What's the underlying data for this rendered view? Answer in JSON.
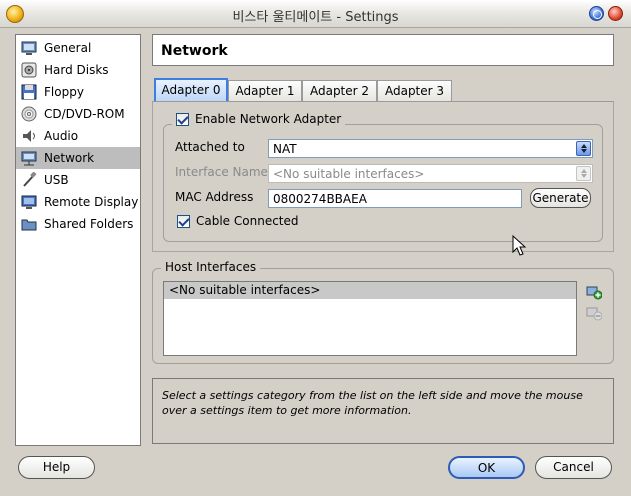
{
  "window": {
    "title": "비스타 울티메이트 - Settings"
  },
  "sidebar": {
    "items": [
      {
        "label": "General",
        "icon": "general-icon",
        "selected": false
      },
      {
        "label": "Hard Disks",
        "icon": "hard-disk-icon",
        "selected": false
      },
      {
        "label": "Floppy",
        "icon": "floppy-icon",
        "selected": false
      },
      {
        "label": "CD/DVD-ROM",
        "icon": "cd-dvd-icon",
        "selected": false
      },
      {
        "label": "Audio",
        "icon": "audio-icon",
        "selected": false
      },
      {
        "label": "Network",
        "icon": "network-icon",
        "selected": true
      },
      {
        "label": "USB",
        "icon": "usb-icon",
        "selected": false
      },
      {
        "label": "Remote Display",
        "icon": "remote-display-icon",
        "selected": false
      },
      {
        "label": "Shared Folders",
        "icon": "shared-folders-icon",
        "selected": false
      }
    ]
  },
  "header": {
    "title": "Network"
  },
  "tabs": [
    {
      "label": "Adapter 0",
      "active": true
    },
    {
      "label": "Adapter 1",
      "active": false
    },
    {
      "label": "Adapter 2",
      "active": false
    },
    {
      "label": "Adapter 3",
      "active": false
    }
  ],
  "adapter": {
    "enable_label": "Enable Network Adapter",
    "enable_checked": true,
    "attached_label": "Attached to",
    "attached_value": "NAT",
    "interface_label": "Interface Name",
    "interface_value": "<No suitable interfaces>",
    "mac_label": "MAC Address",
    "mac_value": "0800274BBAEA",
    "generate_label": "Generate",
    "cable_label": "Cable Connected",
    "cable_checked": true
  },
  "host": {
    "title": "Host Interfaces",
    "items": [
      "<No suitable interfaces>"
    ]
  },
  "info": {
    "text": "Select a settings category from the list on the left side and move the mouse over a settings item to get more information."
  },
  "buttons": {
    "help": "Help",
    "ok": "OK",
    "cancel": "Cancel"
  },
  "colors": {
    "accent": "#3f7ddf",
    "selection": "#bdbdbd",
    "window_bg": "#d4d0c8"
  }
}
